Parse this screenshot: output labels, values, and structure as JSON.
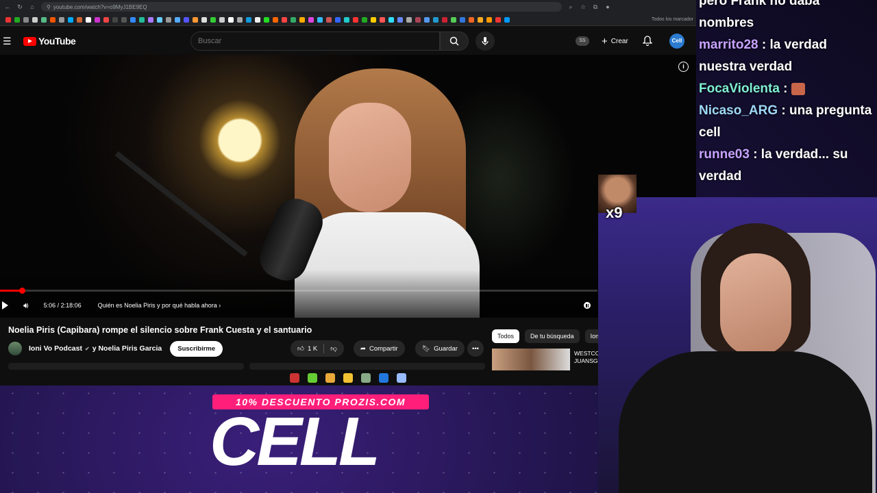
{
  "browser": {
    "url": "youtube.com/watch?v=o9MyJ1BE9EQ",
    "bookmarks_all": "Todos los marcador",
    "bookmark_colors": [
      "#e33",
      "#2a2",
      "#888",
      "#ccc",
      "#5b8",
      "#e50",
      "#999",
      "#0af",
      "#c63",
      "#fff",
      "#c3c",
      "#e44",
      "#444",
      "#555",
      "#38f",
      "#2b9",
      "#a7f",
      "#6cf",
      "#999",
      "#5af",
      "#55f",
      "#f93",
      "#ddd",
      "#3c3",
      "#ccc",
      "#fff",
      "#aaa",
      "#19d",
      "#eee",
      "#2d2",
      "#f60",
      "#f44",
      "#3a6",
      "#fa0",
      "#d4d",
      "#3bf",
      "#c55",
      "#36f",
      "#2cc",
      "#f33",
      "#2a2",
      "#fc0",
      "#f55",
      "#3df",
      "#68f",
      "#aaa",
      "#a45",
      "#59e",
      "#29c",
      "#c23",
      "#5c5",
      "#37d",
      "#e62",
      "#fa2",
      "#f90",
      "#e33",
      "#09f"
    ]
  },
  "header": {
    "logo_text": "YouTube",
    "search_placeholder": "Buscar",
    "ss_badge": "SS",
    "create_label": "Crear",
    "avatar_text": "Cell"
  },
  "player": {
    "current_time": "5:06",
    "duration": "2:18:06",
    "time_display": "5:06 / 2:18:06",
    "chapter": "Quién es Noelia Piris y por qué habla ahora",
    "progress": 0.037
  },
  "video": {
    "title": "Noelia Piris (Capibara) rompe el silencio sobre Frank Cuesta y el santuario",
    "channel": "Ioni Vo Podcast",
    "collab": "y Noelia Piris Garcia",
    "subscribe_label": "Suscribirme",
    "likes": "1 K",
    "share_label": "Compartir",
    "save_label": "Guardar"
  },
  "recommendations": {
    "chips": [
      "Todos",
      "De tu búsqueda",
      "Ioni"
    ],
    "first_title": "WESTCOL JUANSG"
  },
  "taskbar_colors": [
    "#c33",
    "#6c3",
    "#e9a93a",
    "#f1c232",
    "#8a8",
    "#27d",
    "#9bf"
  ],
  "overlay": {
    "emote_multiplier": "x9"
  },
  "chat": {
    "messages": [
      {
        "user": "",
        "text": "pero Frank no daba nombres"
      },
      {
        "user": "marrito28",
        "text": " : la verdad nuestra verdad"
      },
      {
        "user": "FocaViolenta",
        "text": " : "
      },
      {
        "user": "Nicaso_ARG",
        "text": " : una pregunta cell"
      },
      {
        "user": "runne03",
        "text": " : la verdad... su verdad"
      }
    ]
  },
  "sponsor": {
    "banner": "10% DESCUENTO PROZIS.COM",
    "brand": "CELL"
  }
}
